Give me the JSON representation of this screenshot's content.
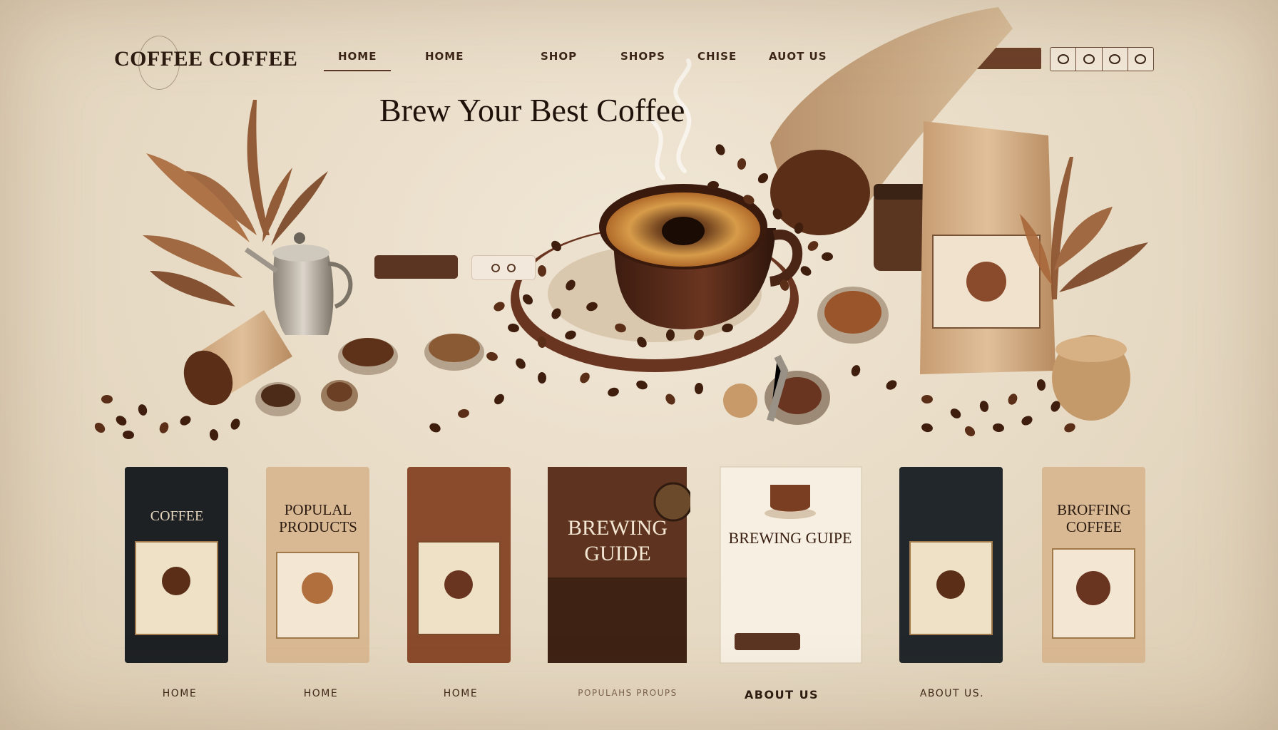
{
  "brand": {
    "name": "COFFEE COFFEE"
  },
  "nav": {
    "items": [
      {
        "label": "HOME",
        "active": true
      },
      {
        "label": "HOME"
      },
      {
        "label": "SHOP"
      },
      {
        "label": "SHOPS"
      },
      {
        "label": "CHISE"
      },
      {
        "label": "AUOT US"
      }
    ],
    "header_cta": "",
    "header_extra": ""
  },
  "hero": {
    "title": "Brew Your Best Coffee",
    "subtitle": "",
    "primary_button": "",
    "body": ""
  },
  "products": [
    {
      "bag_label": "COFFEE",
      "caption": "HOME",
      "style": "dark"
    },
    {
      "bag_label": "POPULAL PRODUCTS",
      "caption": "HOME",
      "style": "kraft"
    },
    {
      "bag_label": "",
      "caption": "HOME",
      "style": "brown"
    },
    {
      "bag_label": "BREWING GUIDE",
      "caption": "POPULAHS PROUPS",
      "style": "guide-dark"
    },
    {
      "bag_label": "BREWING GUIPE",
      "caption": "ABOUT US",
      "style": "guide-light"
    },
    {
      "bag_label": "",
      "caption": "ABOUT US.",
      "style": "dark"
    },
    {
      "bag_label": "BROFFING COFFEE",
      "caption": "",
      "style": "kraft"
    }
  ],
  "colors": {
    "background": "#eadfcd",
    "accent_brown": "#5b3422",
    "dark_text": "#1f120a",
    "bag_dark": "#1e2124",
    "bag_kraft": "#d9b994",
    "bag_brown": "#8a4a2c"
  },
  "icons": [
    "coffee-cup-icon",
    "cart-icon",
    "user-icon",
    "heart-icon"
  ]
}
